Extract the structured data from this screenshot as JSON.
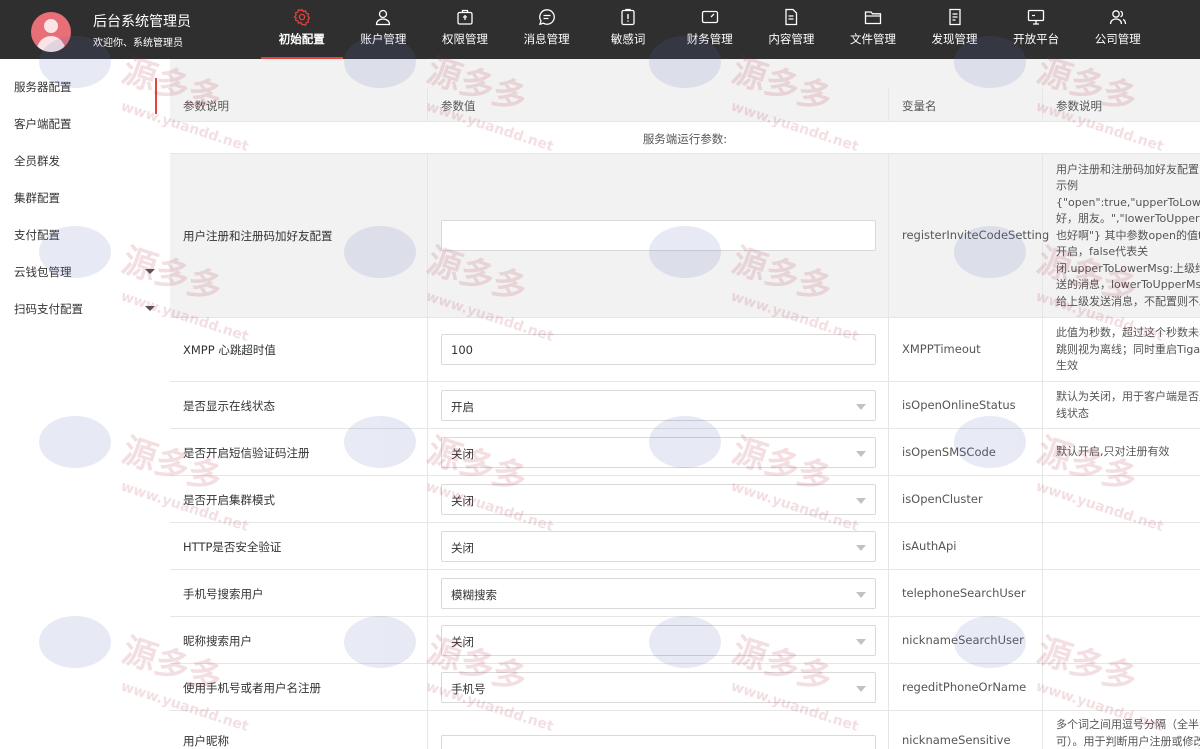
{
  "header": {
    "title": "后台系统管理员",
    "subtitle": "欢迎你、系统管理员"
  },
  "nav": [
    {
      "label": "初始配置",
      "icon": "gear-icon",
      "active": true
    },
    {
      "label": "账户管理",
      "icon": "user-icon"
    },
    {
      "label": "权限管理",
      "icon": "briefcase-icon"
    },
    {
      "label": "消息管理",
      "icon": "chat-icon"
    },
    {
      "label": "敏感词",
      "icon": "clipboard-icon"
    },
    {
      "label": "财务管理",
      "icon": "card-icon"
    },
    {
      "label": "内容管理",
      "icon": "document-icon"
    },
    {
      "label": "文件管理",
      "icon": "folder-icon"
    },
    {
      "label": "发现管理",
      "icon": "file-icon"
    },
    {
      "label": "开放平台",
      "icon": "monitor-icon"
    },
    {
      "label": "公司管理",
      "icon": "users-icon"
    }
  ],
  "sidebar": {
    "items": [
      {
        "label": "服务器配置",
        "active": true
      },
      {
        "label": "客户端配置"
      },
      {
        "label": "全员群发"
      },
      {
        "label": "集群配置"
      },
      {
        "label": "支付配置"
      },
      {
        "label": "云钱包管理",
        "expandable": true
      },
      {
        "label": "扫码支付配置",
        "expandable": true
      }
    ]
  },
  "table": {
    "headers": [
      "参数说明",
      "参数值",
      "变量名",
      "参数说明"
    ],
    "section_title": "服务端运行参数:",
    "rows": [
      {
        "label": "用户注册和注册码加好友配置",
        "type": "input",
        "value": "",
        "var": "registerInviteCodeSetting",
        "desc": [
          "用户注册和注册码加好友配置，",
          "示例",
          "{\"open\":true,\"upperToLowerMsg\":\"你",
          "好，朋友。\",\"lowerToUpperMsg\":\"你",
          "也好啊\"} 其中参数open的值t",
          "开启，false代表关",
          "闭.upperToLowerMsg:上级给下级发",
          "送的消息，lowerToUpperMsg:下级",
          "给上级发送消息，不配置则不发"
        ]
      },
      {
        "label": "XMPP 心跳超时值",
        "type": "input",
        "value": "100",
        "var": "XMPPTimeout",
        "desc": [
          "此值为秒数，超过这个秒数未收到心",
          "跳则视为离线；同时重启Tigase才能",
          "生效"
        ]
      },
      {
        "label": "是否显示在线状态",
        "type": "select",
        "value": "开启",
        "var": "isOpenOnlineStatus",
        "desc": [
          "默认为关闭，用于客户端是否显示在",
          "线状态"
        ]
      },
      {
        "label": "是否开启短信验证码注册",
        "type": "select",
        "value": "关闭",
        "var": "isOpenSMSCode",
        "desc": [
          "默认开启,只对注册有效"
        ]
      },
      {
        "label": "是否开启集群模式",
        "type": "select",
        "value": "关闭",
        "var": "isOpenCluster",
        "desc": []
      },
      {
        "label": "HTTP是否安全验证",
        "type": "select",
        "value": "关闭",
        "var": "isAuthApi",
        "desc": []
      },
      {
        "label": "手机号搜索用户",
        "type": "select",
        "value": "模糊搜索",
        "var": "telephoneSearchUser",
        "desc": []
      },
      {
        "label": "昵称搜索用户",
        "type": "select",
        "value": "关闭",
        "var": "nicknameSearchUser",
        "desc": []
      },
      {
        "label": "使用手机号或者用户名注册",
        "type": "select",
        "value": "手机号",
        "var": "regeditPhoneOrName",
        "desc": []
      },
      {
        "label": "用户昵称",
        "type": "input",
        "value": "",
        "var": "nicknameSensitive",
        "desc": [
          "多个词之间用逗号分隔（全半角均",
          "可）。用于判断用户注册或修改"
        ]
      }
    ]
  },
  "watermark": {
    "text": "源多多",
    "url": "www.yuandd.net",
    "sub": "YUANDD.NET"
  },
  "colors": {
    "topbar": "#2f2f2f",
    "accent": "#e64340",
    "avatar": "#e86f78",
    "table_header": "#f2f2f2"
  }
}
